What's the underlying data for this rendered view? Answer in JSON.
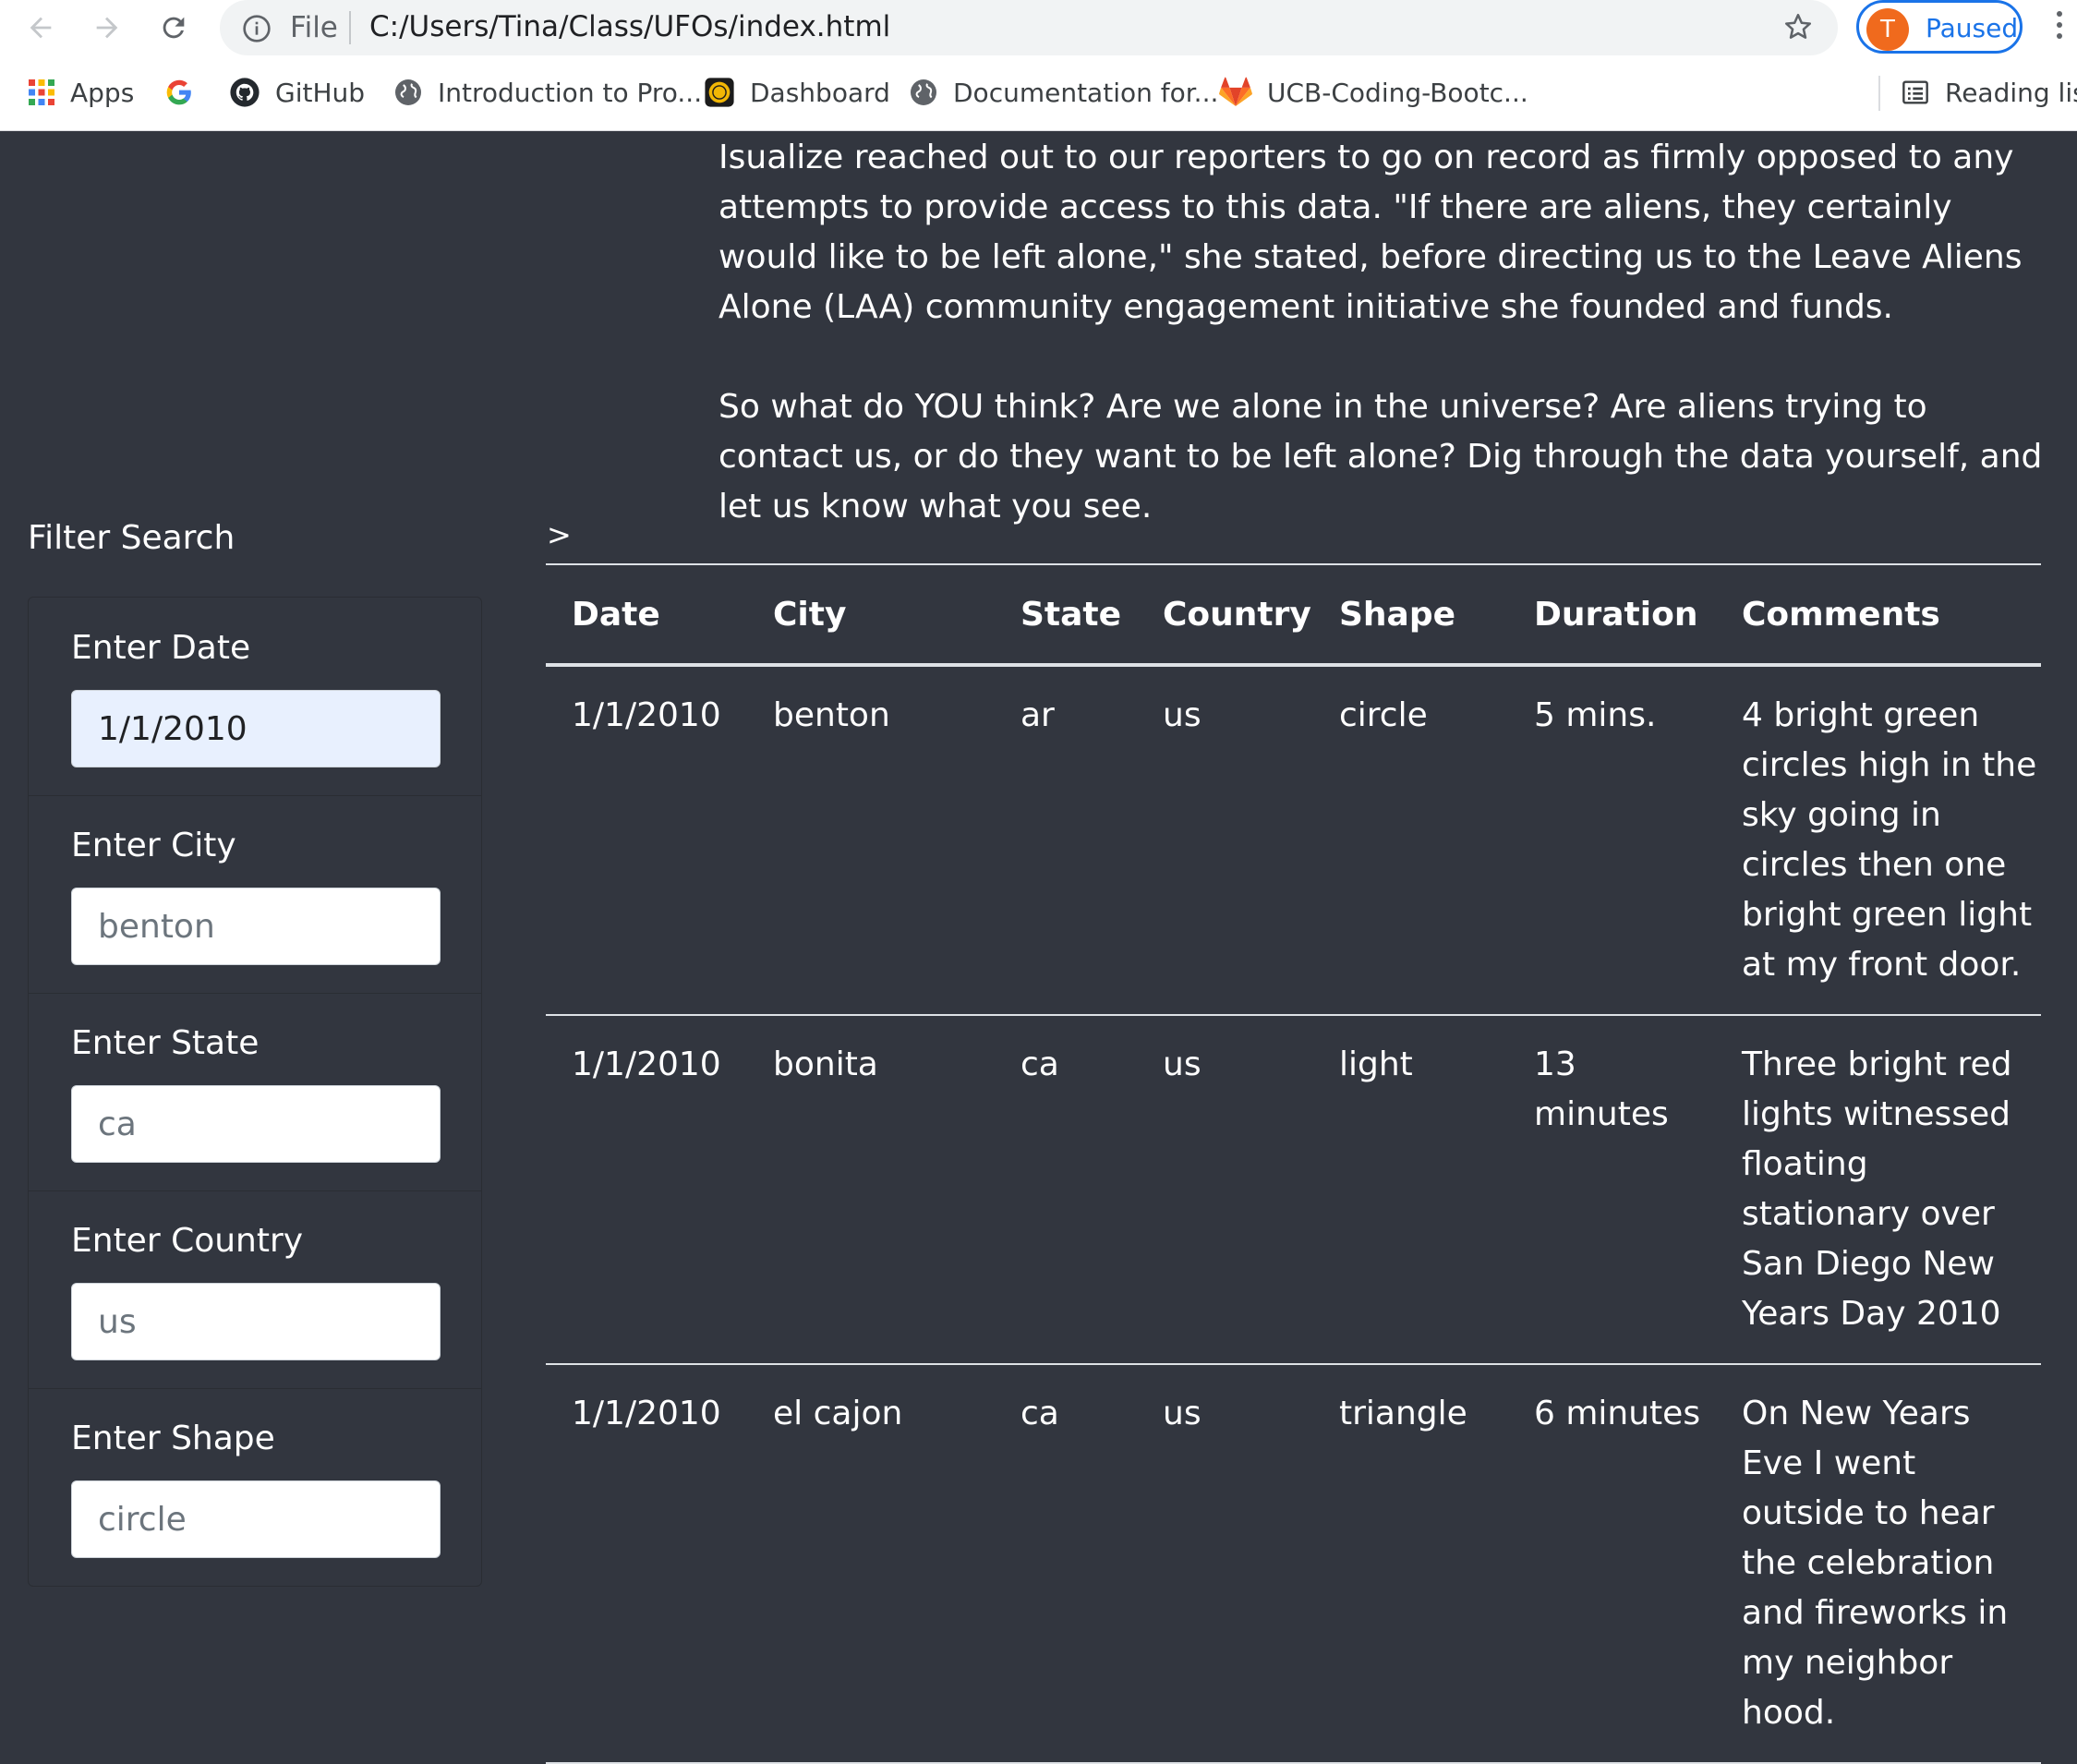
{
  "browser": {
    "omnibox": {
      "scheme_label": "File",
      "url": "C:/Users/Tina/Class/UFOs/index.html"
    },
    "profile": {
      "initial": "T",
      "status": "Paused"
    },
    "bookmarks": [
      {
        "label": "Apps"
      },
      {
        "label": ""
      },
      {
        "label": "GitHub"
      },
      {
        "label": "Introduction to Pro..."
      },
      {
        "label": "Dashboard"
      },
      {
        "label": "Documentation for..."
      },
      {
        "label": "UCB-Coding-Bootc..."
      }
    ],
    "reading_list": "Reading list"
  },
  "article": {
    "paragraph1": "Isualize reached out to our reporters to go on record as firmly opposed to any attempts to provide access to this data. \"If there are aliens, they certainly would like to be left alone,\" she stated, before directing us to the Leave Aliens Alone (LAA) community engagement initiative she founded and funds.",
    "paragraph2": "So what do YOU think? Are we alone in the universe? Are aliens trying to contact us, or do they want to be left alone? Dig through the data yourself, and let us know what you see."
  },
  "filters": {
    "title": "Filter Search",
    "fields": [
      {
        "label": "Enter Date",
        "value": "1/1/2010",
        "placeholder": ""
      },
      {
        "label": "Enter City",
        "value": "",
        "placeholder": "benton"
      },
      {
        "label": "Enter State",
        "value": "",
        "placeholder": "ca"
      },
      {
        "label": "Enter Country",
        "value": "",
        "placeholder": "us"
      },
      {
        "label": "Enter Shape",
        "value": "",
        "placeholder": "circle"
      }
    ]
  },
  "table": {
    "caret": ">",
    "headers": [
      "Date",
      "City",
      "State",
      "Country",
      "Shape",
      "Duration",
      "Comments"
    ],
    "rows": [
      [
        "1/1/2010",
        "benton",
        "ar",
        "us",
        "circle",
        "5 mins.",
        "4 bright green circles high in the sky going in circles then one bright green light at my front door."
      ],
      [
        "1/1/2010",
        "bonita",
        "ca",
        "us",
        "light",
        "13 minutes",
        "Three bright red lights witnessed floating stationary over San Diego New Years Day 2010"
      ],
      [
        "1/1/2010",
        "el cajon",
        "ca",
        "us",
        "triangle",
        "6 minutes",
        "On New Years Eve I went outside to hear the celebration and fireworks in my neighbor hood."
      ]
    ]
  },
  "colors": {
    "page_bg": "#32363f",
    "accent": "#1a73e8",
    "avatar": "#f06a1d"
  }
}
